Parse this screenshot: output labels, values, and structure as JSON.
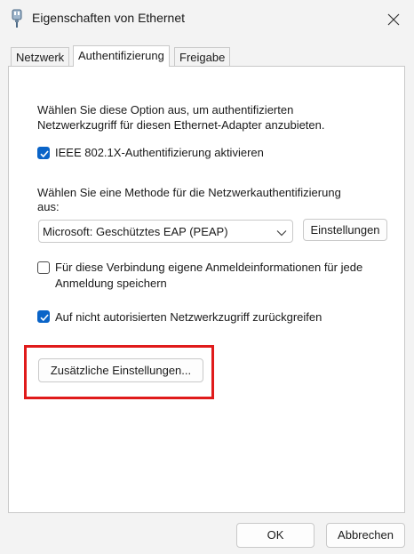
{
  "window": {
    "title": "Eigenschaften von Ethernet",
    "icon": "network-adapter-icon",
    "close_icon": "close-icon"
  },
  "tabs": [
    {
      "label": "Netzwerk",
      "active": false
    },
    {
      "label": "Authentifizierung",
      "active": true
    },
    {
      "label": "Freigabe",
      "active": false
    }
  ],
  "auth": {
    "intro_line1": "Wählen Sie diese Option aus, um authentifizierten",
    "intro_line2": "Netzwerkzugriff für diesen Ethernet-Adapter anzubieten.",
    "enable_8021x": {
      "label": "IEEE 802.1X-Authentifizierung aktivieren",
      "checked": true
    },
    "method_line1": "Wählen Sie eine Methode für die Netzwerkauthentifizierung",
    "method_line2": "aus:",
    "method_select_value": "Microsoft: Geschütztes EAP (PEAP)",
    "settings_button": "Einstellungen",
    "remember_credentials": {
      "label_line1": "Für diese Verbindung eigene Anmeldeinformationen für jede",
      "label_line2": "Anmeldung speichern",
      "checked": false
    },
    "fallback_unauthorized": {
      "label": "Auf nicht autorisierten Netzwerkzugriff zurückgreifen",
      "checked": true
    },
    "additional_settings_button": "Zusätzliche Einstellungen..."
  },
  "footer": {
    "ok_button": "OK",
    "cancel_button": "Abbrechen"
  },
  "colors": {
    "accent": "#0a64c8",
    "highlight": "#e01b1b",
    "panel_bg": "#ffffff",
    "window_bg": "#f3f3f3"
  }
}
